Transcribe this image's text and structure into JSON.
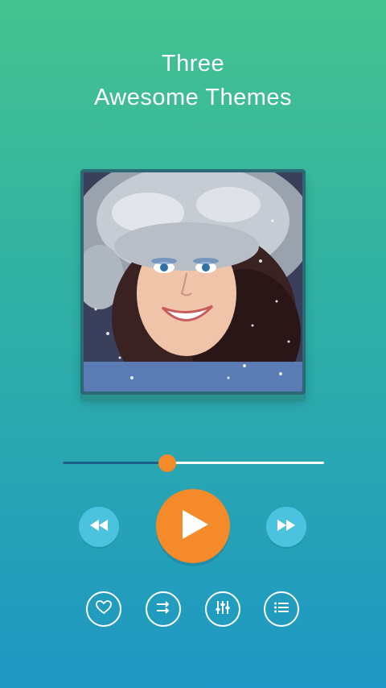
{
  "header": {
    "title_line1": "Three",
    "title_line2": "Awesome Themes"
  },
  "player": {
    "album_art": "woman-in-fur-hat-snow",
    "progress_fraction": 0.4,
    "controls": {
      "rewind_icon": "rewind-icon",
      "play_icon": "play-icon",
      "forward_icon": "fast-forward-icon"
    },
    "actions": [
      {
        "name": "favorite",
        "icon": "heart-icon"
      },
      {
        "name": "shuffle",
        "icon": "shuffle-icon"
      },
      {
        "name": "equalizer",
        "icon": "equalizer-icon"
      },
      {
        "name": "playlist",
        "icon": "list-icon"
      }
    ],
    "colors": {
      "accent": "#f58a2a",
      "secondary_button": "#4bc3df",
      "progress_played": "#1c5f86"
    }
  }
}
